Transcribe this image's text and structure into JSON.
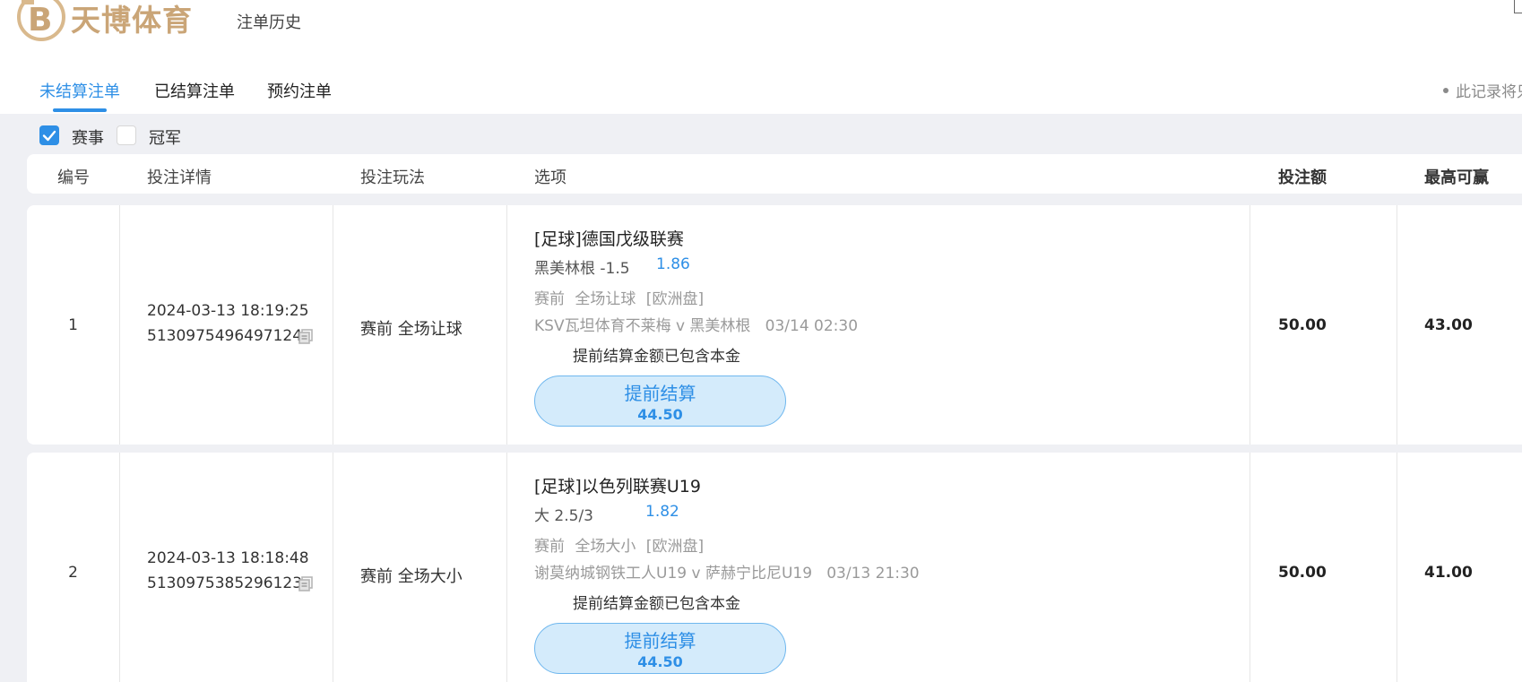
{
  "header": {
    "brand": "天博体育",
    "title": "注单历史"
  },
  "tabs": [
    {
      "label": "未结算注单",
      "active": true
    },
    {
      "label": "已结算注单",
      "active": false
    },
    {
      "label": "预约注单",
      "active": false
    }
  ],
  "notice": "此记录将只",
  "filters": [
    {
      "label": "赛事",
      "checked": true
    },
    {
      "label": "冠军",
      "checked": false
    }
  ],
  "columns": {
    "no": "编号",
    "detail": "投注详情",
    "play": "投注玩法",
    "option": "选项",
    "stake": "投注额",
    "max_win": "最高可赢"
  },
  "bets": [
    {
      "no": "1",
      "time": "2024-03-13 18:19:25",
      "id": "5130975496497124",
      "play": "赛前 全场让球",
      "league": "[足球]德国戊级联赛",
      "pick": "黑美林根 -1.5",
      "odds": "1.86",
      "meta": "赛前 全场让球 [欧洲盘]",
      "match": "KSV瓦坦体育不莱梅 v 黑美林根   03/14 02:30",
      "note": "提前结算金额已包含本金",
      "cashout_label": "提前结算",
      "cashout_amount": "44.50",
      "stake": "50.00",
      "max_win": "43.00"
    },
    {
      "no": "2",
      "time": "2024-03-13 18:18:48",
      "id": "5130975385296123",
      "play": "赛前 全场大小",
      "league": "[足球]以色列联赛U19",
      "pick": "大 2.5/3",
      "odds": "1.82",
      "meta": "赛前 全场大小 [欧洲盘]",
      "match": "谢莫纳城钢铁工人U19 v 萨赫宁比尼U19   03/13 21:30",
      "note": "提前结算金额已包含本金",
      "cashout_label": "提前结算",
      "cashout_amount": "44.50",
      "stake": "50.00",
      "max_win": "41.00"
    }
  ],
  "colors": {
    "accent": "#2e8fe6",
    "brand": "#caa577",
    "background": "#eff0f4",
    "button_fill": "#d4ebfb"
  }
}
